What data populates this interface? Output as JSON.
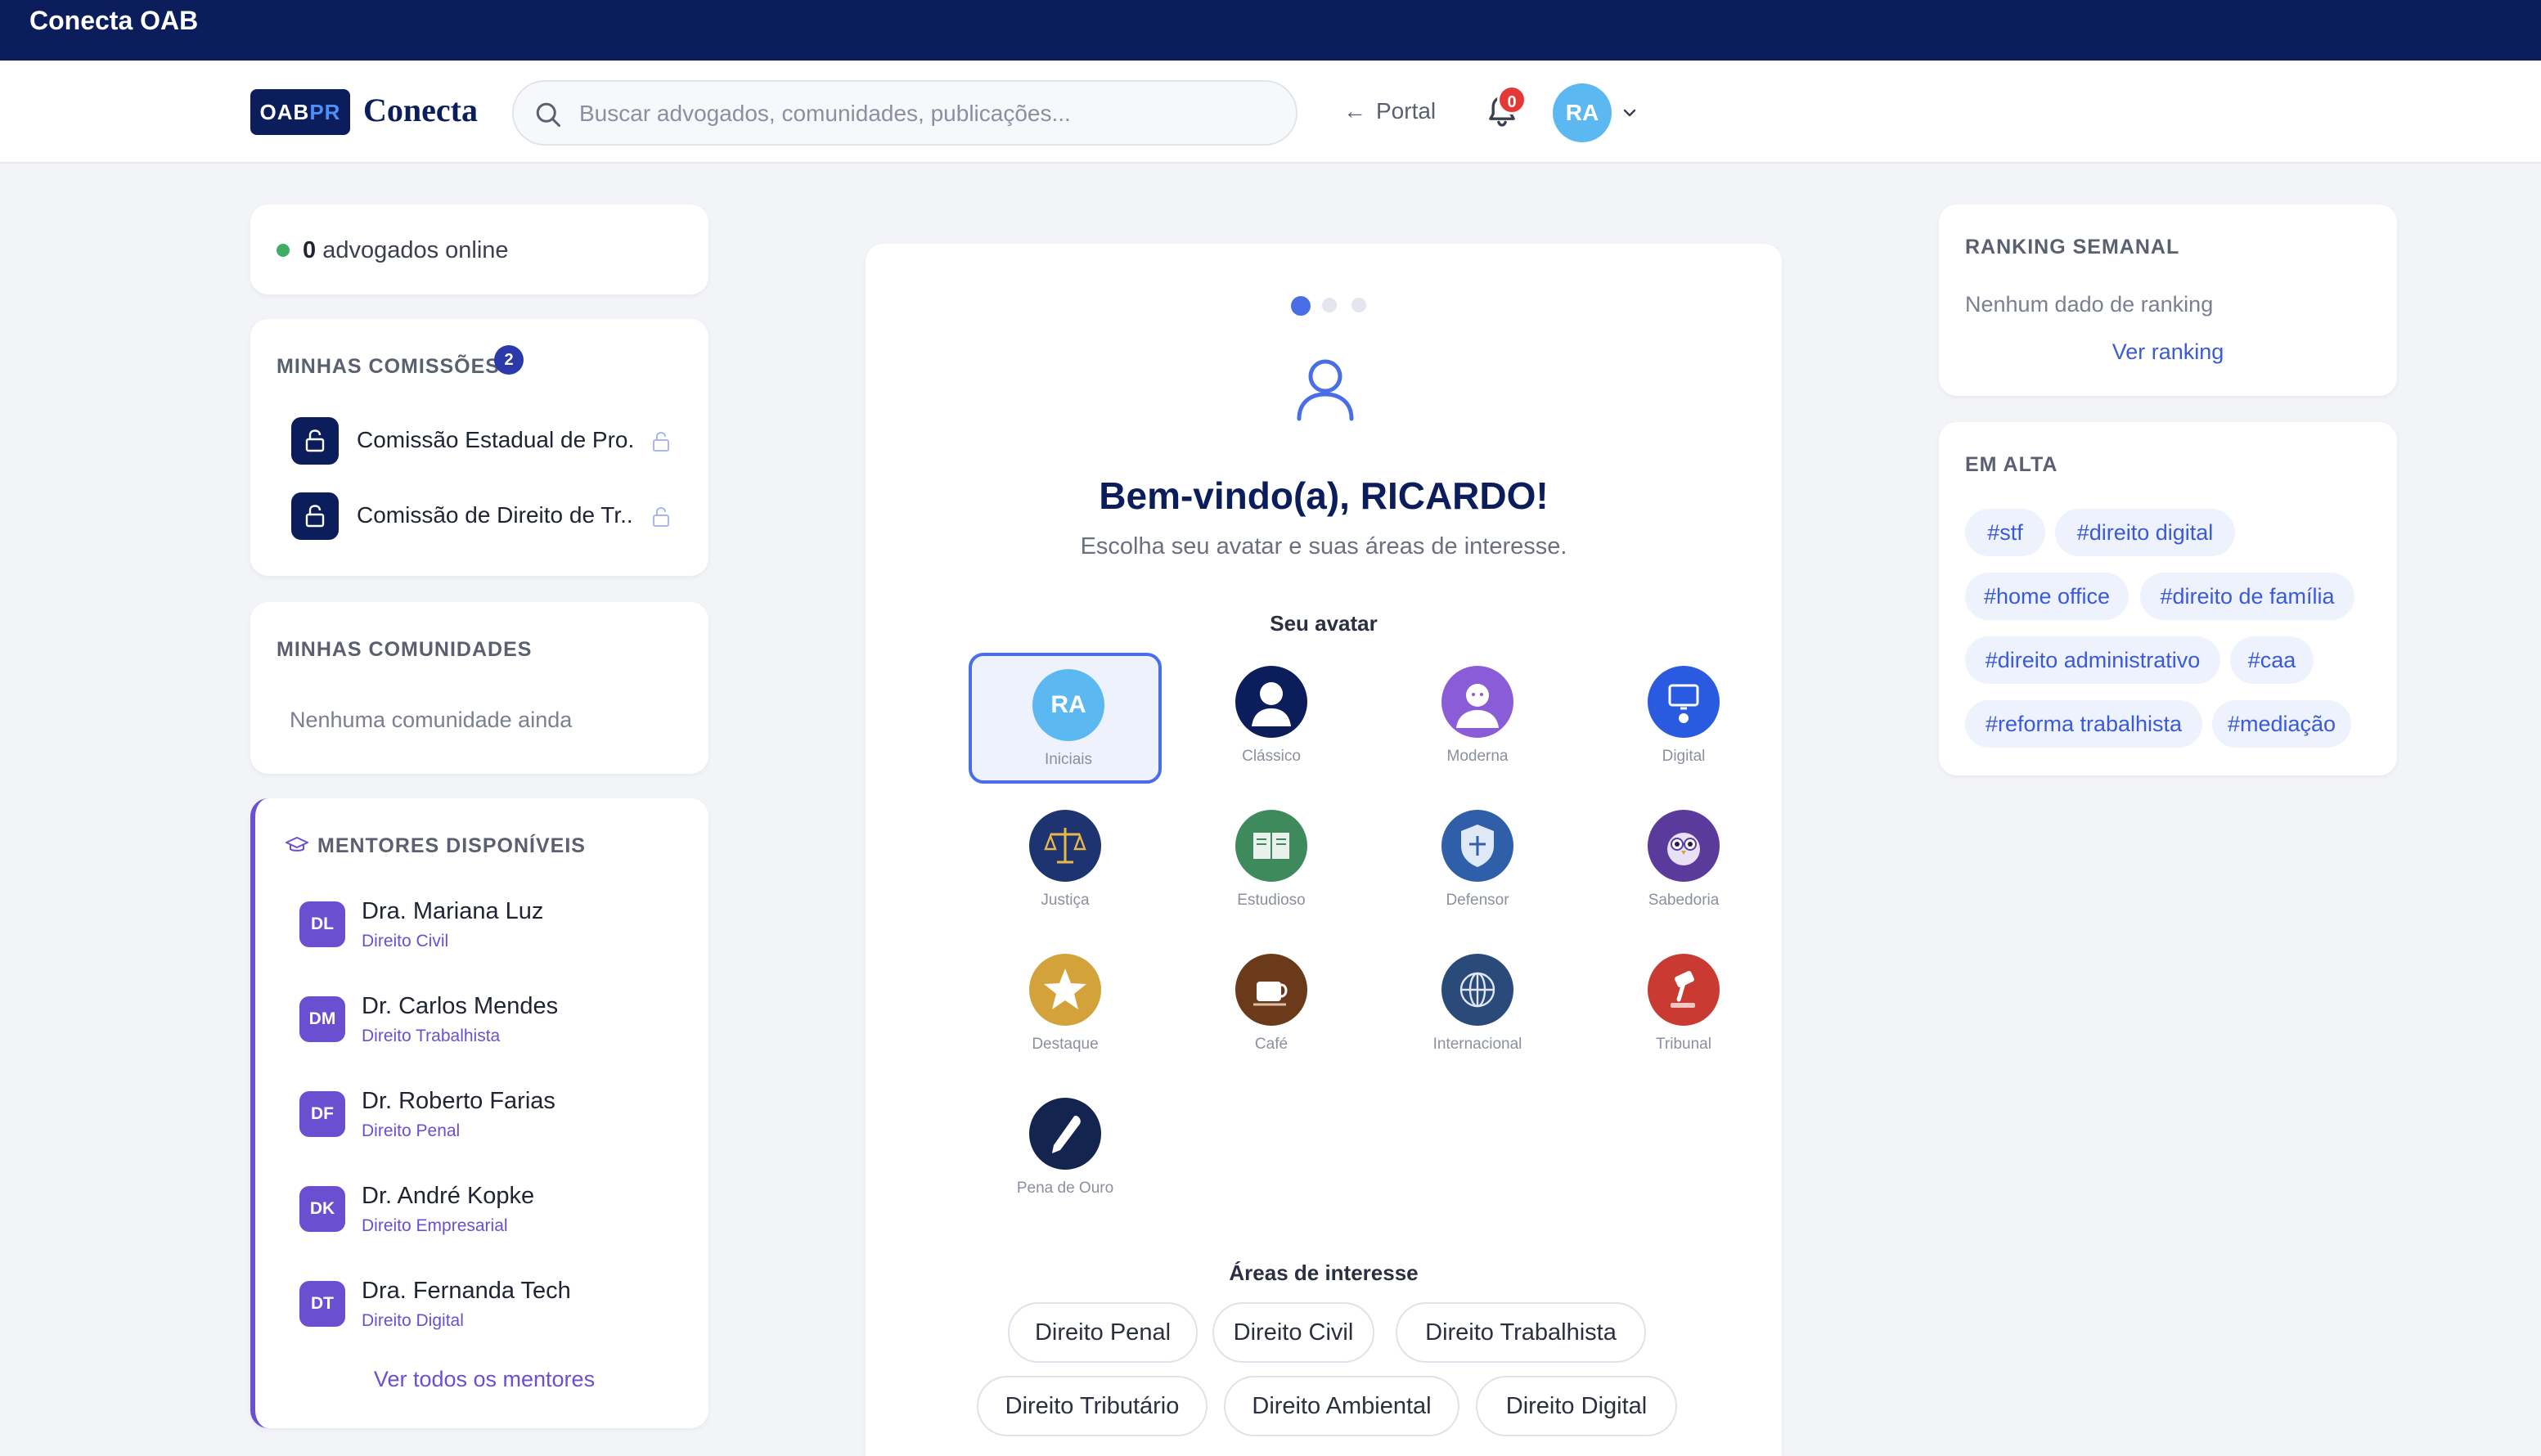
{
  "window": {
    "title": "Conecta OAB"
  },
  "header": {
    "logo_oab": "OAB",
    "logo_pr": "PR",
    "logo_text": "Conecta",
    "search_placeholder": "Buscar advogados, comunidades, publicações...",
    "portal_label": "Portal",
    "notifications_count": "0",
    "user_initials": "RA"
  },
  "online": {
    "count": "0",
    "label": "advogados online"
  },
  "comissoes": {
    "title": "MINHAS COMISSÕES",
    "count": "2",
    "items": [
      {
        "label": "Comissão Estadual de Pro..."
      },
      {
        "label": "Comissão de Direito de Tr..."
      }
    ]
  },
  "comunidades": {
    "title": "MINHAS COMUNIDADES",
    "empty": "Nenhuma comunidade ainda"
  },
  "mentores": {
    "title": "MENTORES DISPONÍVEIS",
    "items": [
      {
        "initials": "DL",
        "name": "Dra. Mariana Luz",
        "area": "Direito Civil"
      },
      {
        "initials": "DM",
        "name": "Dr. Carlos Mendes",
        "area": "Direito Trabalhista"
      },
      {
        "initials": "DF",
        "name": "Dr. Roberto Farias",
        "area": "Direito Penal"
      },
      {
        "initials": "DK",
        "name": "Dr. André Kopke",
        "area": "Direito Empresarial"
      },
      {
        "initials": "DT",
        "name": "Dra. Fernanda Tech",
        "area": "Direito Digital"
      }
    ],
    "see_all": "Ver todos os mentores"
  },
  "onboarding": {
    "welcome": "Bem-vindo(a), RICARDO!",
    "subtitle": "Escolha seu avatar e suas áreas de interesse.",
    "avatar_label": "Seu avatar",
    "avatars": [
      {
        "name": "Iniciais",
        "text": "RA",
        "color": "#5bb8f0",
        "icon": "initials"
      },
      {
        "name": "Clássico",
        "color": "#0b1e5b",
        "icon": "person-icon"
      },
      {
        "name": "Moderna",
        "color": "#8a5cd8",
        "icon": "woman-icon"
      },
      {
        "name": "Digital",
        "color": "#2a5ae0",
        "icon": "monitor-icon"
      },
      {
        "name": "Justiça",
        "color": "#1e3470",
        "icon": "scales-icon"
      },
      {
        "name": "Estudioso",
        "color": "#3e8a5c",
        "icon": "book-icon"
      },
      {
        "name": "Defensor",
        "color": "#2f5fa8",
        "icon": "shield-icon"
      },
      {
        "name": "Sabedoria",
        "color": "#5a3a9a",
        "icon": "owl-icon"
      },
      {
        "name": "Destaque",
        "color": "#d4a23a",
        "icon": "star-icon"
      },
      {
        "name": "Café",
        "color": "#6a3a1a",
        "icon": "coffee-icon"
      },
      {
        "name": "Internacional",
        "color": "#2a4a7a",
        "icon": "globe-icon"
      },
      {
        "name": "Tribunal",
        "color": "#c83a32",
        "icon": "gavel-icon"
      },
      {
        "name": "Pena de Ouro",
        "color": "#13244f",
        "icon": "pen-icon"
      }
    ],
    "areas_label": "Áreas de interesse",
    "areas": [
      "Direito Penal",
      "Direito Civil",
      "Direito Trabalhista",
      "Direito Tributário",
      "Direito Ambiental",
      "Direito Digital"
    ]
  },
  "ranking": {
    "title": "RANKING SEMANAL",
    "empty": "Nenhum dado de ranking",
    "link": "Ver ranking"
  },
  "alta": {
    "title": "EM ALTA",
    "tags": [
      "#stf",
      "#direito digital",
      "#home office",
      "#direito de família",
      "#direito administrativo",
      "#caa",
      "#reforma trabalhista",
      "#mediação"
    ]
  },
  "colors": {
    "brand_navy": "#0b1e5b",
    "accent_blue": "#4a6ee8",
    "mentor_purple": "#6a4fd0",
    "online_green": "#3fae64",
    "badge_red": "#e53935"
  }
}
